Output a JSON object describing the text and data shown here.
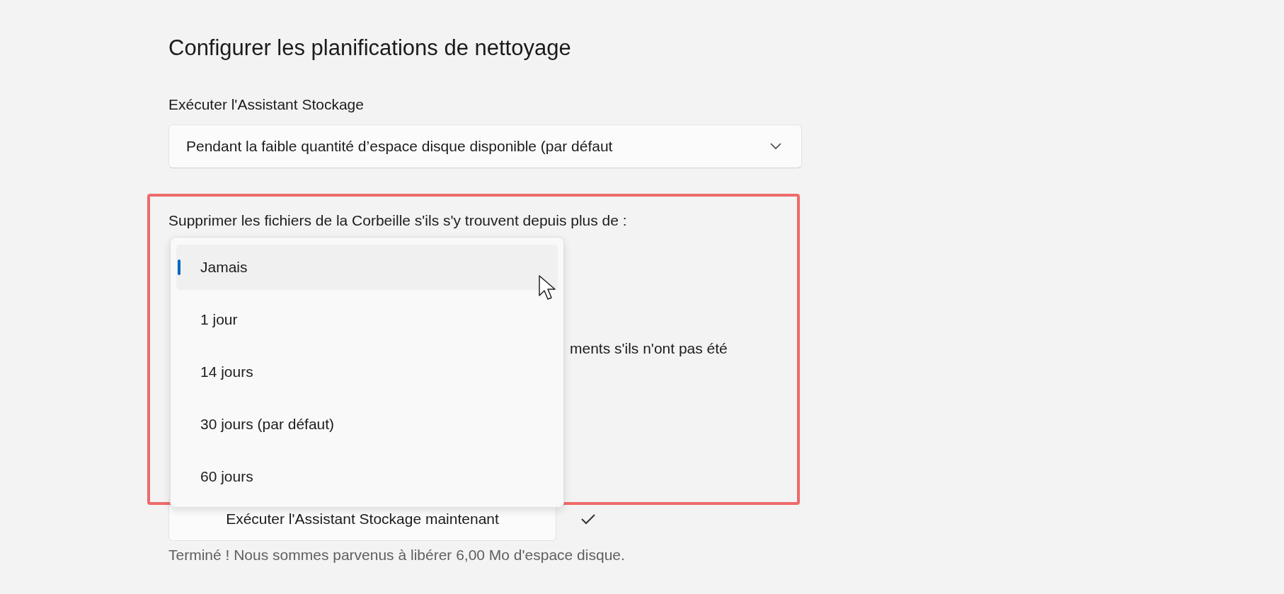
{
  "heading": "Configurer les planifications de nettoyage",
  "run_storage_sense": {
    "label": "Exécuter l'Assistant Stockage",
    "value": "Pendant la faible quantité d’espace disque disponible (par défaut"
  },
  "recycle_bin": {
    "label": "Supprimer les fichiers de la Corbeille s'ils s'y trouvent depuis plus de :",
    "menu": [
      {
        "label": "Jamais",
        "selected": true
      },
      {
        "label": "1 jour",
        "selected": false
      },
      {
        "label": "14 jours",
        "selected": false
      },
      {
        "label": "30 jours (par défaut)",
        "selected": false
      },
      {
        "label": "60 jours",
        "selected": false
      }
    ]
  },
  "downloads_label_fragment": "ments s'ils n'ont pas été",
  "run_now_button": {
    "label": "Exécuter l'Assistant Stockage maintenant"
  },
  "status": "Terminé ! Nous sommes parvenus à libérer 6,00 Mo d'espace disque.",
  "annotation": {
    "kind": "highlight",
    "color": "#ee6a6a"
  }
}
